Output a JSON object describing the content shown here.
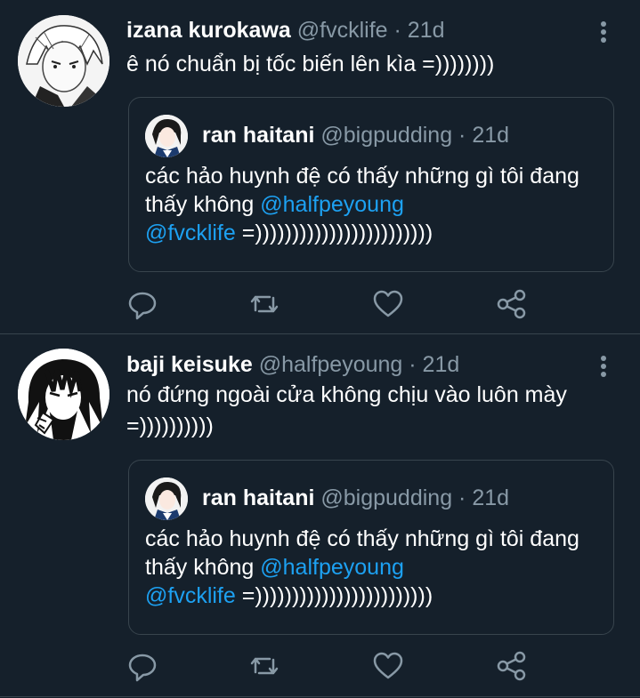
{
  "tweets": [
    {
      "name": "izana kurokawa",
      "handle": "@fvcklife",
      "time": "· 21d",
      "text": "ê nó chuẩn bị tốc biến lên kìa =))))))))",
      "quote": {
        "name": "ran haitani",
        "handle": "@bigpudding",
        "time": "· 21d",
        "text_before": "các hảo huynh đệ có thấy những gì tôi đang thấy không ",
        "mention1": "@halfpeyoung",
        "mention2": "@fvcklife",
        "text_after": " =))))))))))))))))))))))))"
      }
    },
    {
      "name": "baji keisuke",
      "handle": "@halfpeyoung",
      "time": "· 21d",
      "text": "nó đứng ngoài cửa không chịu vào luôn mày =))))))))))",
      "quote": {
        "name": "ran haitani",
        "handle": "@bigpudding",
        "time": "· 21d",
        "text_before": "các hảo huynh đệ có thấy những gì tôi đang thấy không ",
        "mention1": "@halfpeyoung",
        "mention2": "@fvcklife",
        "text_after": " =))))))))))))))))))))))))"
      }
    }
  ],
  "icons": {
    "reply": "reply-icon",
    "retweet": "retweet-icon",
    "like": "heart-icon",
    "share": "share-icon",
    "more": "more-vertical-icon"
  },
  "colors": {
    "background": "#15202b",
    "secondary_text": "#8899a6",
    "link": "#1da1f2",
    "border": "#38444d"
  }
}
